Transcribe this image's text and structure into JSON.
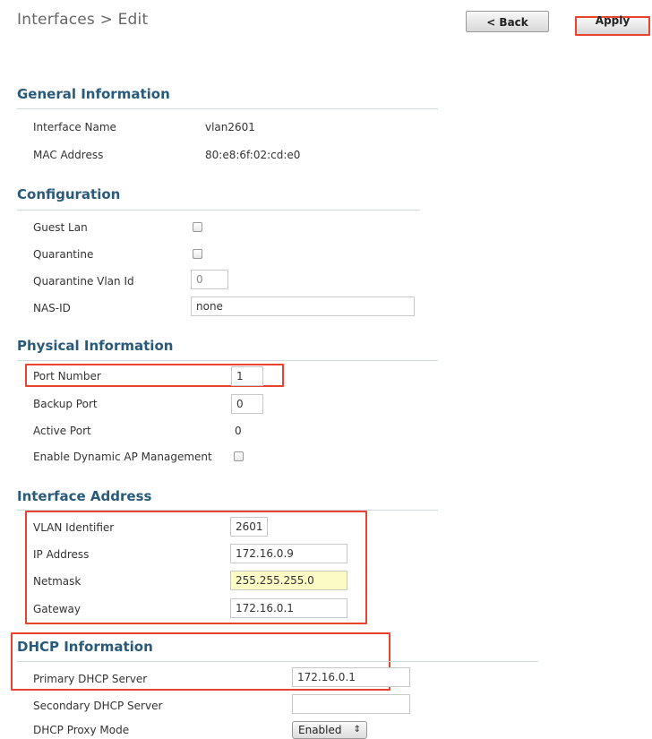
{
  "header": {
    "title": "Interfaces > Edit",
    "back_label": "< Back",
    "apply_label": "Apply"
  },
  "general": {
    "title": "General Information",
    "interface_name_label": "Interface Name",
    "interface_name_value": "vlan2601",
    "mac_label": "MAC Address",
    "mac_value": "80:e8:6f:02:cd:e0"
  },
  "configuration": {
    "title": "Configuration",
    "guest_lan_label": "Guest Lan",
    "quarantine_label": "Quarantine",
    "quarantine_vlan_label": "Quarantine Vlan Id",
    "quarantine_vlan_value": "0",
    "nas_id_label": "NAS-ID",
    "nas_id_value": "none"
  },
  "physical": {
    "title": "Physical Information",
    "port_number_label": "Port Number",
    "port_number_value": "1",
    "backup_port_label": "Backup Port",
    "backup_port_value": "0",
    "active_port_label": "Active Port",
    "active_port_value": "0",
    "dynamic_ap_label": "Enable Dynamic AP Management"
  },
  "interface_address": {
    "title": "Interface Address",
    "vlan_label": "VLAN Identifier",
    "vlan_value": "2601",
    "ip_label": "IP Address",
    "ip_value": "172.16.0.9",
    "netmask_label": "Netmask",
    "netmask_value": "255.255.255.0",
    "gateway_label": "Gateway",
    "gateway_value": "172.16.0.1"
  },
  "dhcp": {
    "title": "DHCP Information",
    "primary_label": "Primary DHCP Server",
    "primary_value": "172.16.0.1",
    "secondary_label": "Secondary DHCP Server",
    "secondary_value": "",
    "proxy_label": "DHCP Proxy Mode",
    "proxy_value": "Enabled"
  },
  "colors": {
    "highlight": "#e8432f",
    "section_title": "#2a5a7a",
    "netmask_bg": "#fbfbc6"
  }
}
